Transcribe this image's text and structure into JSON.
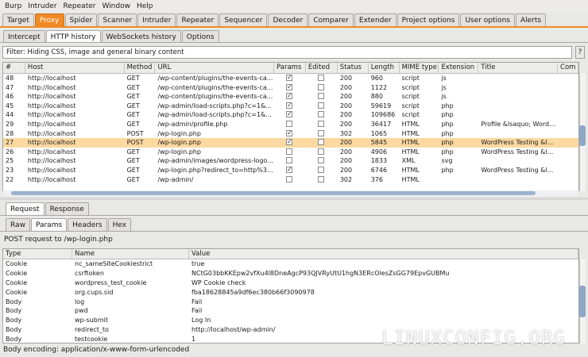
{
  "menu": [
    "Burp",
    "Intruder",
    "Repeater",
    "Window",
    "Help"
  ],
  "main_tabs": [
    "Target",
    "Proxy",
    "Spider",
    "Scanner",
    "Intruder",
    "Repeater",
    "Sequencer",
    "Decoder",
    "Comparer",
    "Extender",
    "Project options",
    "User options",
    "Alerts"
  ],
  "proxy_tabs": [
    "Intercept",
    "HTTP history",
    "WebSockets history",
    "Options"
  ],
  "filter": {
    "text": "Filter: Hiding CSS, image and general binary content",
    "button": "?"
  },
  "history": {
    "columns": [
      "#",
      "Host",
      "Method",
      "URL",
      "Params",
      "Edited",
      "Status",
      "Length",
      "MIME type",
      "Extension",
      "Title",
      "Com"
    ],
    "rows": [
      {
        "num": "48",
        "host": "http://localhost",
        "method": "GET",
        "url": "/wp-content/plugins/the-events-ca...",
        "params": true,
        "edited": false,
        "status": "200",
        "length": "960",
        "mime": "script",
        "ext": "js",
        "title": ""
      },
      {
        "num": "47",
        "host": "http://localhost",
        "method": "GET",
        "url": "/wp-content/plugins/the-events-ca...",
        "params": true,
        "edited": false,
        "status": "200",
        "length": "1122",
        "mime": "script",
        "ext": "js",
        "title": ""
      },
      {
        "num": "46",
        "host": "http://localhost",
        "method": "GET",
        "url": "/wp-content/plugins/the-events-ca...",
        "params": true,
        "edited": false,
        "status": "200",
        "length": "880",
        "mime": "script",
        "ext": "js",
        "title": ""
      },
      {
        "num": "45",
        "host": "http://localhost",
        "method": "GET",
        "url": "/wp-admin/load-scripts.php?c=1&...",
        "params": true,
        "edited": false,
        "status": "200",
        "length": "59619",
        "mime": "script",
        "ext": "php",
        "title": ""
      },
      {
        "num": "44",
        "host": "http://localhost",
        "method": "GET",
        "url": "/wp-admin/load-scripts.php?c=1&...",
        "params": true,
        "edited": false,
        "status": "200",
        "length": "109686",
        "mime": "script",
        "ext": "php",
        "title": ""
      },
      {
        "num": "29",
        "host": "http://localhost",
        "method": "GET",
        "url": "/wp-admin/profile.php",
        "params": false,
        "edited": false,
        "status": "200",
        "length": "36417",
        "mime": "HTML",
        "ext": "php",
        "title": "Profile &lsaquo; Word..."
      },
      {
        "num": "28",
        "host": "http://localhost",
        "method": "POST",
        "url": "/wp-login.php",
        "params": true,
        "edited": false,
        "status": "302",
        "length": "1065",
        "mime": "HTML",
        "ext": "php",
        "title": ""
      },
      {
        "num": "27",
        "host": "http://localhost",
        "method": "POST",
        "url": "/wp-login.php",
        "params": true,
        "edited": false,
        "status": "200",
        "length": "5845",
        "mime": "HTML",
        "ext": "php",
        "title": "WordPress Testing &l...",
        "selected": true
      },
      {
        "num": "26",
        "host": "http://localhost",
        "method": "GET",
        "url": "/wp-login.php",
        "params": false,
        "edited": false,
        "status": "200",
        "length": "4906",
        "mime": "HTML",
        "ext": "php",
        "title": "WordPress Testing &l..."
      },
      {
        "num": "25",
        "host": "http://localhost",
        "method": "GET",
        "url": "/wp-admin/images/wordpress-logo...",
        "params": false,
        "edited": false,
        "status": "200",
        "length": "1833",
        "mime": "XML",
        "ext": "svg",
        "title": ""
      },
      {
        "num": "23",
        "host": "http://localhost",
        "method": "GET",
        "url": "/wp-login.php?redirect_to=http%3...",
        "params": true,
        "edited": false,
        "status": "200",
        "length": "6746",
        "mime": "HTML",
        "ext": "php",
        "title": "WordPress Testing &l..."
      },
      {
        "num": "22",
        "host": "http://localhost",
        "method": "GET",
        "url": "/wp-admin/",
        "params": false,
        "edited": false,
        "status": "302",
        "length": "376",
        "mime": "HTML",
        "ext": "",
        "title": ""
      }
    ]
  },
  "detail_tabs": [
    "Request",
    "Response"
  ],
  "view_tabs": [
    "Raw",
    "Params",
    "Headers",
    "Hex"
  ],
  "post_info": "POST request to /wp-login.php",
  "params": {
    "columns": [
      "Type",
      "Name",
      "Value"
    ],
    "rows": [
      {
        "type": "Cookie",
        "name": "nc_sameSiteCookiestrict",
        "value": "true"
      },
      {
        "type": "Cookie",
        "name": "csrftoken",
        "value": "NCtG03bbKKEpw2vfXu4l8DneAgcP93QJVRyUtU1hgN3ERcOlesZsGG79EpvGUBMu"
      },
      {
        "type": "Cookie",
        "name": "wordpress_test_cookie",
        "value": "WP Cookie check"
      },
      {
        "type": "Cookie",
        "name": "org.cups.sid",
        "value": "fba18628845a9df6ec380b66f3090978"
      },
      {
        "type": "Body",
        "name": "log",
        "value": "Fail"
      },
      {
        "type": "Body",
        "name": "pwd",
        "value": "Fail"
      },
      {
        "type": "Body",
        "name": "wp-submit",
        "value": "Log In"
      },
      {
        "type": "Body",
        "name": "redirect_to",
        "value": "http://localhost/wp-admin/"
      },
      {
        "type": "Body",
        "name": "testcookie",
        "value": "1"
      }
    ]
  },
  "encoding": "Body encoding: application/x-www-form-urlencoded",
  "watermark": "LINUXCONFIG.ORG",
  "colors": {
    "accent": "#f08a24",
    "selected_row": "#fbd9a1"
  }
}
